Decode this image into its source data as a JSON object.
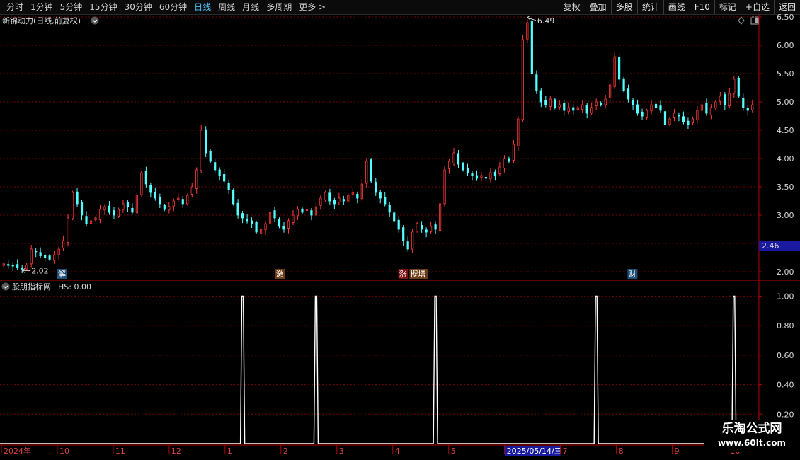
{
  "toolbar": {
    "periods": [
      "分时",
      "1分钟",
      "5分钟",
      "15分钟",
      "30分钟",
      "60分钟",
      "日线",
      "周线",
      "月线",
      "多周期",
      "更多 >"
    ],
    "active_period": "日线",
    "right_buttons": [
      "复权",
      "叠加",
      "多股",
      "统计",
      "画线",
      "F10",
      "标记",
      "+自选",
      "返回"
    ]
  },
  "main_panel": {
    "title": "新锦动力(日线,前复权)",
    "high_label": "6.49",
    "low_label": "2.02",
    "current_price_tag": "2.46"
  },
  "event_markers": [
    {
      "label": "解",
      "bg": "#1e4f77",
      "fg": "#ffffff",
      "date_index": 1.0
    },
    {
      "label": "激",
      "bg": "#6b3c14",
      "fg": "#ffffff",
      "date_index": 4.9
    },
    {
      "label": "涨",
      "bg": "#7a1212",
      "fg": "#ffffff",
      "date_index": 7.1
    },
    {
      "label": "楔增",
      "bg": "#6b3c14",
      "fg": "#ffffff",
      "date_index": 7.3
    },
    {
      "label": "财",
      "bg": "#1e4f77",
      "fg": "#ffffff",
      "date_index": 11.2
    }
  ],
  "indicator_panel": {
    "title": "股朋指标网",
    "hs_label": "HS: 0.00"
  },
  "date_axis": {
    "labels": [
      "2024年",
      "10",
      "11",
      "12",
      "1",
      "2",
      "3",
      "4",
      "5",
      "2025/05/14/三",
      "7",
      "8",
      "9",
      "10"
    ],
    "highlight": "2025/05/14/三"
  },
  "watermark": {
    "line1": "乐淘公式网",
    "line2": "www.60lt.com"
  },
  "colors": {
    "up": "#ff3c3c",
    "down": "#54ffff",
    "grid": "#7a0000",
    "axis": "#b40000",
    "line": "#ffffff"
  },
  "chart_data": [
    {
      "type": "candlestick",
      "title": "新锦动力(日线,前复权)",
      "y_ticks": [
        2.0,
        2.5,
        3.0,
        3.5,
        4.0,
        4.5,
        5.0,
        5.5,
        6.0,
        6.5
      ],
      "ylim": [
        1.85,
        6.55
      ],
      "max": 6.49,
      "min": 2.02,
      "close_series": [
        2.14,
        2.11,
        2.1,
        2.08,
        2.05,
        2.12,
        2.4,
        2.35,
        2.28,
        2.25,
        2.22,
        2.3,
        2.4,
        2.55,
        2.95,
        3.4,
        3.2,
        3.0,
        2.85,
        2.9,
        2.95,
        3.1,
        3.15,
        3.05,
        3.0,
        3.1,
        3.2,
        3.15,
        3.05,
        3.35,
        3.75,
        3.55,
        3.4,
        3.3,
        3.2,
        3.1,
        3.15,
        3.25,
        3.3,
        3.2,
        3.35,
        3.5,
        3.8,
        4.5,
        4.1,
        3.95,
        3.8,
        3.7,
        3.6,
        3.45,
        3.2,
        3.0,
        2.95,
        2.9,
        2.85,
        2.7,
        2.75,
        2.85,
        3.05,
        2.95,
        2.8,
        2.75,
        2.9,
        3.0,
        3.1,
        3.05,
        3.1,
        3.0,
        3.15,
        3.3,
        3.4,
        3.25,
        3.2,
        3.3,
        3.25,
        3.35,
        3.4,
        3.3,
        3.55,
        3.95,
        3.6,
        3.4,
        3.3,
        3.2,
        3.05,
        2.9,
        2.75,
        2.55,
        2.4,
        2.7,
        2.85,
        2.75,
        2.7,
        2.8,
        2.75,
        3.2,
        3.8,
        3.95,
        4.1,
        3.9,
        3.8,
        3.75,
        3.7,
        3.65,
        3.7,
        3.65,
        3.75,
        3.7,
        3.85,
        4.0,
        3.95,
        4.25,
        4.7,
        6.1,
        6.4,
        5.5,
        5.2,
        5.0,
        4.95,
        5.05,
        4.9,
        4.95,
        4.85,
        4.9,
        4.85,
        4.9,
        4.95,
        4.8,
        4.9,
        5.0,
        4.95,
        5.05,
        5.3,
        5.8,
        5.4,
        5.2,
        5.05,
        4.95,
        4.8,
        4.75,
        4.85,
        4.95,
        4.9,
        4.85,
        4.6,
        4.7,
        4.8,
        4.75,
        4.65,
        4.6,
        4.7,
        4.85,
        4.95,
        4.8,
        4.9,
        5.0,
        5.1,
        4.95,
        5.15,
        5.4,
        5.1,
        4.9,
        4.85,
        4.95
      ]
    },
    {
      "type": "line",
      "title": "股朋指标网",
      "y_ticks": [
        0.2,
        0.4,
        0.6,
        0.8,
        1.0
      ],
      "ylim": [
        0,
        1.05
      ],
      "spike_indices": [
        52,
        68,
        94,
        129,
        159
      ],
      "baseline": 0
    }
  ]
}
